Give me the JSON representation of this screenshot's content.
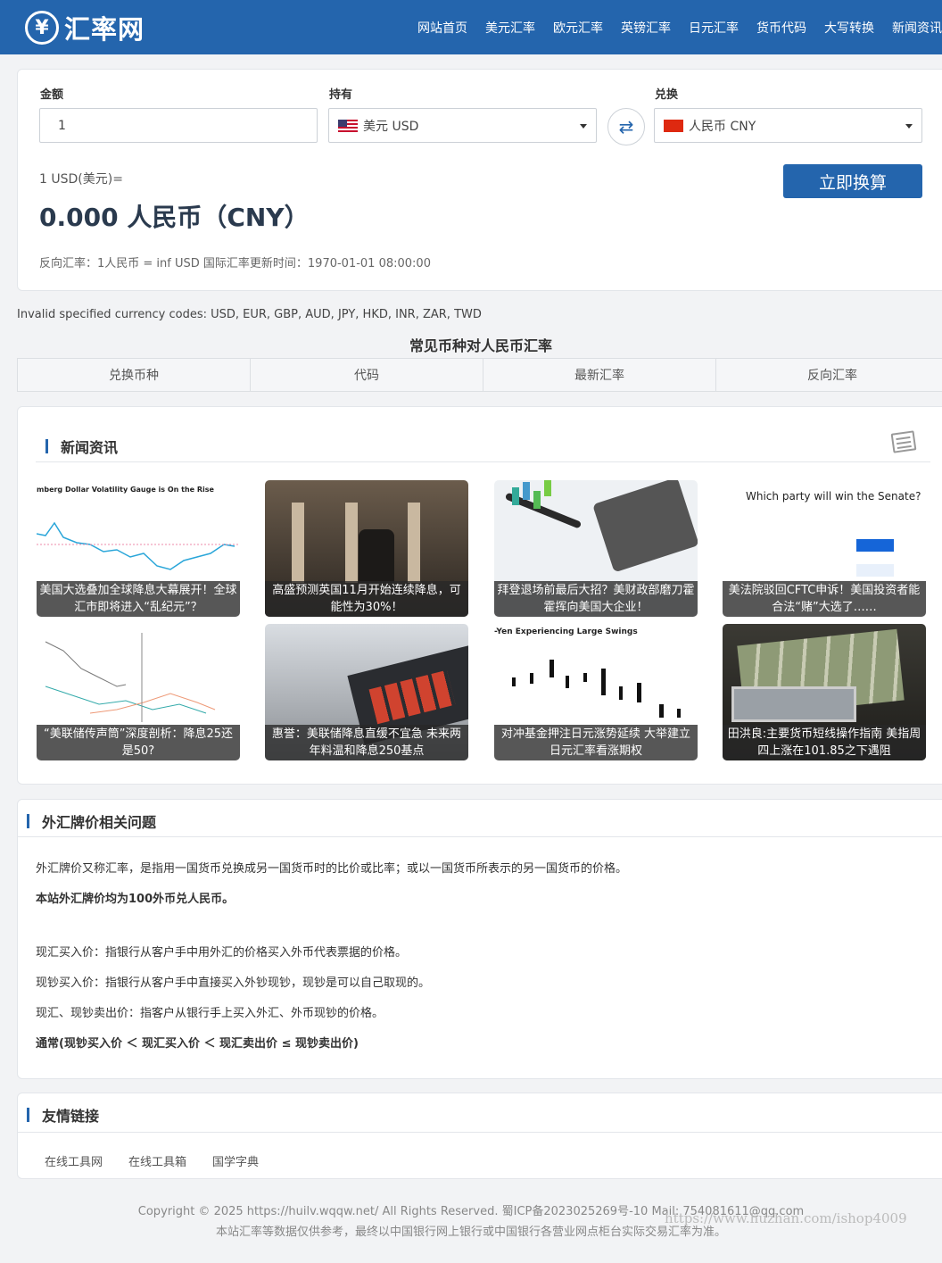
{
  "header": {
    "logo_text": "汇率网",
    "logo_symbol": "¥",
    "nav": [
      "网站首页",
      "美元汇率",
      "欧元汇率",
      "英镑汇率",
      "日元汇率",
      "货币代码",
      "大写转换",
      "新闻资讯"
    ]
  },
  "converter": {
    "amount_label": "金额",
    "amount_value": "1",
    "from_label": "持有",
    "from_value": "美元 USD",
    "to_label": "兑换",
    "to_value": "人民币 CNY",
    "swap_icon": "⇄",
    "submit_label": "立即换算",
    "rate_line": "1 USD(美元)=",
    "result": "0.000 人民币（CNY）",
    "reverse_line": "反向汇率：1人民币 = inf USD  国际汇率更新时间：1970-01-01 08:00:00"
  },
  "error_message": "Invalid specified currency codes: USD, EUR, GBP, AUD, JPY, HKD, INR, ZAR, TWD",
  "rates_table": {
    "title": "常见币种对人民币汇率",
    "headers": [
      "兑换币种",
      "代码",
      "最新汇率",
      "反向汇率"
    ]
  },
  "news": {
    "title": "新闻资讯",
    "items": [
      {
        "caption": "美国大选叠加全球降息大幕展开！全球汇市即将进入“乱纪元”？",
        "image_text": "mberg Dollar Volatility Gauge is On the Rise"
      },
      {
        "caption": "高盛预测英国11月开始连续降息，可能性为30%！",
        "image_text": ""
      },
      {
        "caption": "拜登退场前最后大招？美财政部磨刀霍霍挥向美国大企业！",
        "image_text": ""
      },
      {
        "caption": "美法院驳回CFTC申诉！美国投资者能合法“赌”大选了……",
        "image_text": "Which party will win the Senate?"
      },
      {
        "caption": "“美联储传声筒”深度剖析：降息25还是50?",
        "image_text": ""
      },
      {
        "caption": "惠誉：美联储降息直缓不宜急 未来两年料温和降息250基点",
        "image_text": ""
      },
      {
        "caption": "对冲基金押注日元涨势延续 大举建立日元汇率看涨期权",
        "image_text": "-Yen Experiencing Large Swings"
      },
      {
        "caption": "田洪良:主要货币短线操作指南 美指周四上涨在101.85之下遇阻",
        "image_text": ""
      }
    ]
  },
  "faq": {
    "title": "外汇牌价相关问题",
    "paragraphs": [
      "外汇牌价又称汇率，是指用一国货币兑换成另一国货币时的比价或比率；或以一国货币所表示的另一国货币的价格。",
      "本站外汇牌价均为100外币兑人民币。",
      "现汇买入价：指银行从客户手中用外汇的价格买入外币代表票据的价格。",
      "现钞买入价：指银行从客户手中直接买入外钞现钞，现钞是可以自己取现的。",
      "现汇、现钞卖出价：指客户从银行手上买入外汇、外币现钞的价格。",
      "通常(现钞买入价 ＜ 现汇买入价 ＜ 现汇卖出价 ≤ 现钞卖出价)"
    ]
  },
  "links": {
    "title": "友情链接",
    "items": [
      "在线工具网",
      "在线工具箱",
      "国学字典"
    ]
  },
  "footer": {
    "copyright": "Copyright © 2025 https://huilv.wqqw.net/ All Rights Reserved.  蜀ICP备2023025269号-10  Mail: 754081611@qq.com",
    "disclaimer": "本站汇率等数据仅供参考，最终以中国银行网上银行或中国银行各营业网点柜台实际交易汇率为准。",
    "watermark": "https://www.huzhan.com/ishop4009"
  },
  "colors": {
    "brand": "#2465ad",
    "background": "#f2f3f5"
  }
}
